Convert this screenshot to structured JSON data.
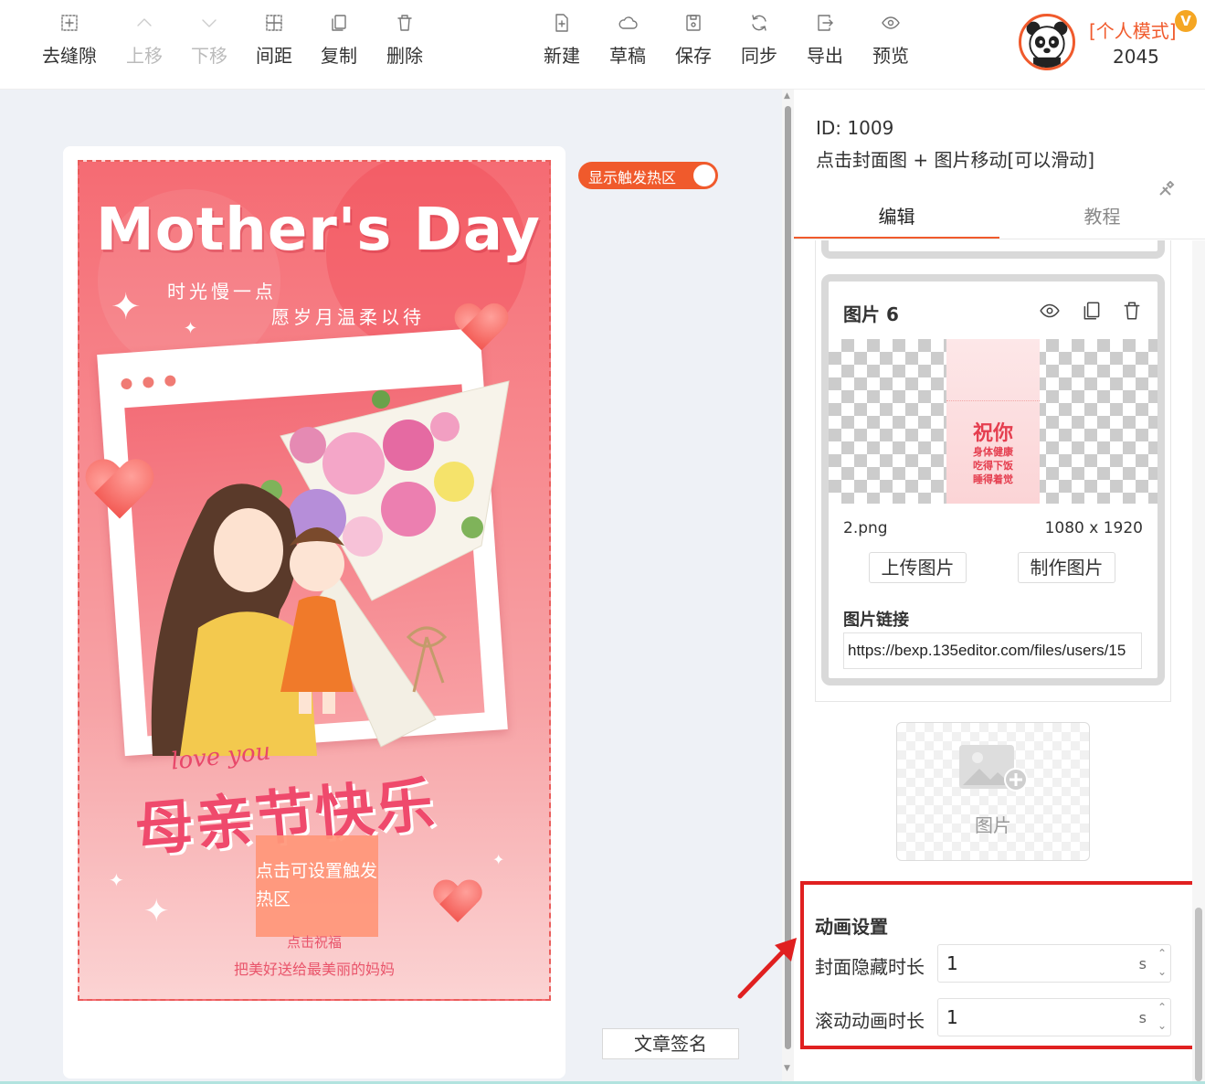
{
  "toolbar": {
    "left": [
      {
        "label": "去缝隙",
        "icon": "remove-gap-icon",
        "disabled": false
      },
      {
        "label": "上移",
        "icon": "chevron-up-icon",
        "disabled": true
      },
      {
        "label": "下移",
        "icon": "chevron-down-icon",
        "disabled": true
      },
      {
        "label": "间距",
        "icon": "spacing-icon",
        "disabled": false
      },
      {
        "label": "复制",
        "icon": "copy-icon",
        "disabled": false
      },
      {
        "label": "删除",
        "icon": "trash-icon",
        "disabled": false
      }
    ],
    "right": [
      {
        "label": "新建",
        "icon": "new-file-icon"
      },
      {
        "label": "草稿",
        "icon": "cloud-icon"
      },
      {
        "label": "保存",
        "icon": "save-icon"
      },
      {
        "label": "同步",
        "icon": "sync-icon"
      },
      {
        "label": "导出",
        "icon": "export-icon"
      },
      {
        "label": "预览",
        "icon": "eye-icon"
      }
    ]
  },
  "user": {
    "mode": "[个人模式]",
    "vip_badge": "V",
    "number": "2045"
  },
  "canvas": {
    "hotspot_toggle_label": "显示触发热区",
    "hotspot_toggle_on": true,
    "poster": {
      "title": "Mother's Day",
      "subtitle_line1": "时光慢一点",
      "subtitle_line2": "愿岁月温柔以待",
      "love_you": "love you",
      "big_title": "母亲节快乐",
      "hotspot_text": "点击可设置触发热区",
      "tap_text": "点击祝福",
      "caption": "把美好送给最美丽的妈妈"
    },
    "signature_button": "文章签名"
  },
  "panel": {
    "id_line": "ID: 1009",
    "description": "点击封面图 + 图片移动[可以滑动]",
    "tabs": [
      {
        "label": "编辑",
        "active": true
      },
      {
        "label": "教程",
        "active": false
      }
    ],
    "image_card": {
      "title": "图片 6",
      "preview_lines": [
        "祝你",
        "身体健康",
        "吃得下饭",
        "睡得着觉"
      ],
      "filename": "2.png",
      "dimensions": "1080 x 1920",
      "upload_button": "上传图片",
      "make_button": "制作图片",
      "link_label": "图片链接",
      "link_value": "https://bexp.135editor.com/files/users/15"
    },
    "add_image_label": "图片",
    "animation": {
      "section_title": "动画设置",
      "cover_hide_label": "封面隐藏时长",
      "cover_hide_value": "1",
      "scroll_label": "滚动动画时长",
      "scroll_value": "1",
      "unit": "s"
    }
  },
  "colors": {
    "accent": "#f05a2c",
    "highlight_box": "#e02020",
    "poster_pink": "#f56b73"
  }
}
